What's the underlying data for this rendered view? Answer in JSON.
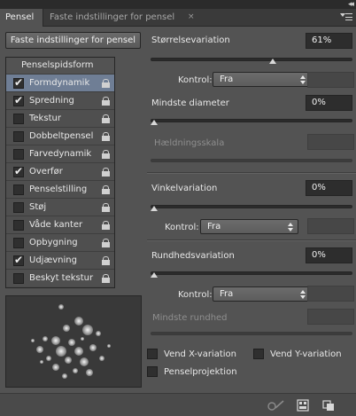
{
  "tabs": [
    {
      "label": "Pensel",
      "active": true
    },
    {
      "label": "Faste indstillinger for pensel",
      "active": false
    }
  ],
  "tab_close": "×",
  "collapse_glyph": "◂◂",
  "preset_button": "Faste indstillinger for pensel",
  "list": {
    "header": "Penselspidsform",
    "items": [
      {
        "label": "Formdynamik",
        "checked": true,
        "selected": true
      },
      {
        "label": "Spredning",
        "checked": true,
        "selected": false
      },
      {
        "label": "Tekstur",
        "checked": false,
        "selected": false
      },
      {
        "label": "Dobbeltpensel",
        "checked": false,
        "selected": false
      },
      {
        "label": "Farvedynamik",
        "checked": false,
        "selected": false
      },
      {
        "label": "Overfør",
        "checked": true,
        "selected": false
      },
      {
        "label": "Penselstilling",
        "checked": false,
        "selected": false
      },
      {
        "label": "Støj",
        "checked": false,
        "selected": false
      },
      {
        "label": "Våde kanter",
        "checked": false,
        "selected": false
      },
      {
        "label": "Opbygning",
        "checked": false,
        "selected": false
      },
      {
        "label": "Udjævning",
        "checked": true,
        "selected": false
      },
      {
        "label": "Beskyt tekstur",
        "checked": false,
        "selected": false
      }
    ]
  },
  "settings": {
    "size_jitter": {
      "label": "Størrelsevariation",
      "value": "61%",
      "level": 0.61
    },
    "size_control": {
      "label": "Kontrol:",
      "value": "Fra"
    },
    "min_diameter": {
      "label": "Mindste diameter",
      "value": "0%",
      "level": 0.0
    },
    "tilt_scale": {
      "label": "Hældningsskala",
      "value": ""
    },
    "angle_jitter": {
      "label": "Vinkelvariation",
      "value": "0%",
      "level": 0.0
    },
    "angle_control": {
      "label": "Kontrol:",
      "value": "Fra"
    },
    "roundness_jitter": {
      "label": "Rundhedsvariation",
      "value": "0%",
      "level": 0.0
    },
    "roundness_control": {
      "label": "Kontrol:",
      "value": "Fra"
    },
    "min_roundness": {
      "label": "Mindste rundhed",
      "value": ""
    }
  },
  "options": {
    "flip_x": {
      "label": "Vend X-variation",
      "checked": false
    },
    "flip_y": {
      "label": "Vend Y-variation",
      "checked": false
    },
    "brush_projection": {
      "label": "Penselprojektion",
      "checked": false
    }
  },
  "colors": {
    "panel_bg": "#535353",
    "selected_row": "#6f7e95",
    "field_bg": "#2d2d2d"
  },
  "icons": [
    "panel-menu-icon",
    "lock-icon",
    "toggle-live-tip-icon",
    "grid-icon",
    "new-preset-icon"
  ]
}
